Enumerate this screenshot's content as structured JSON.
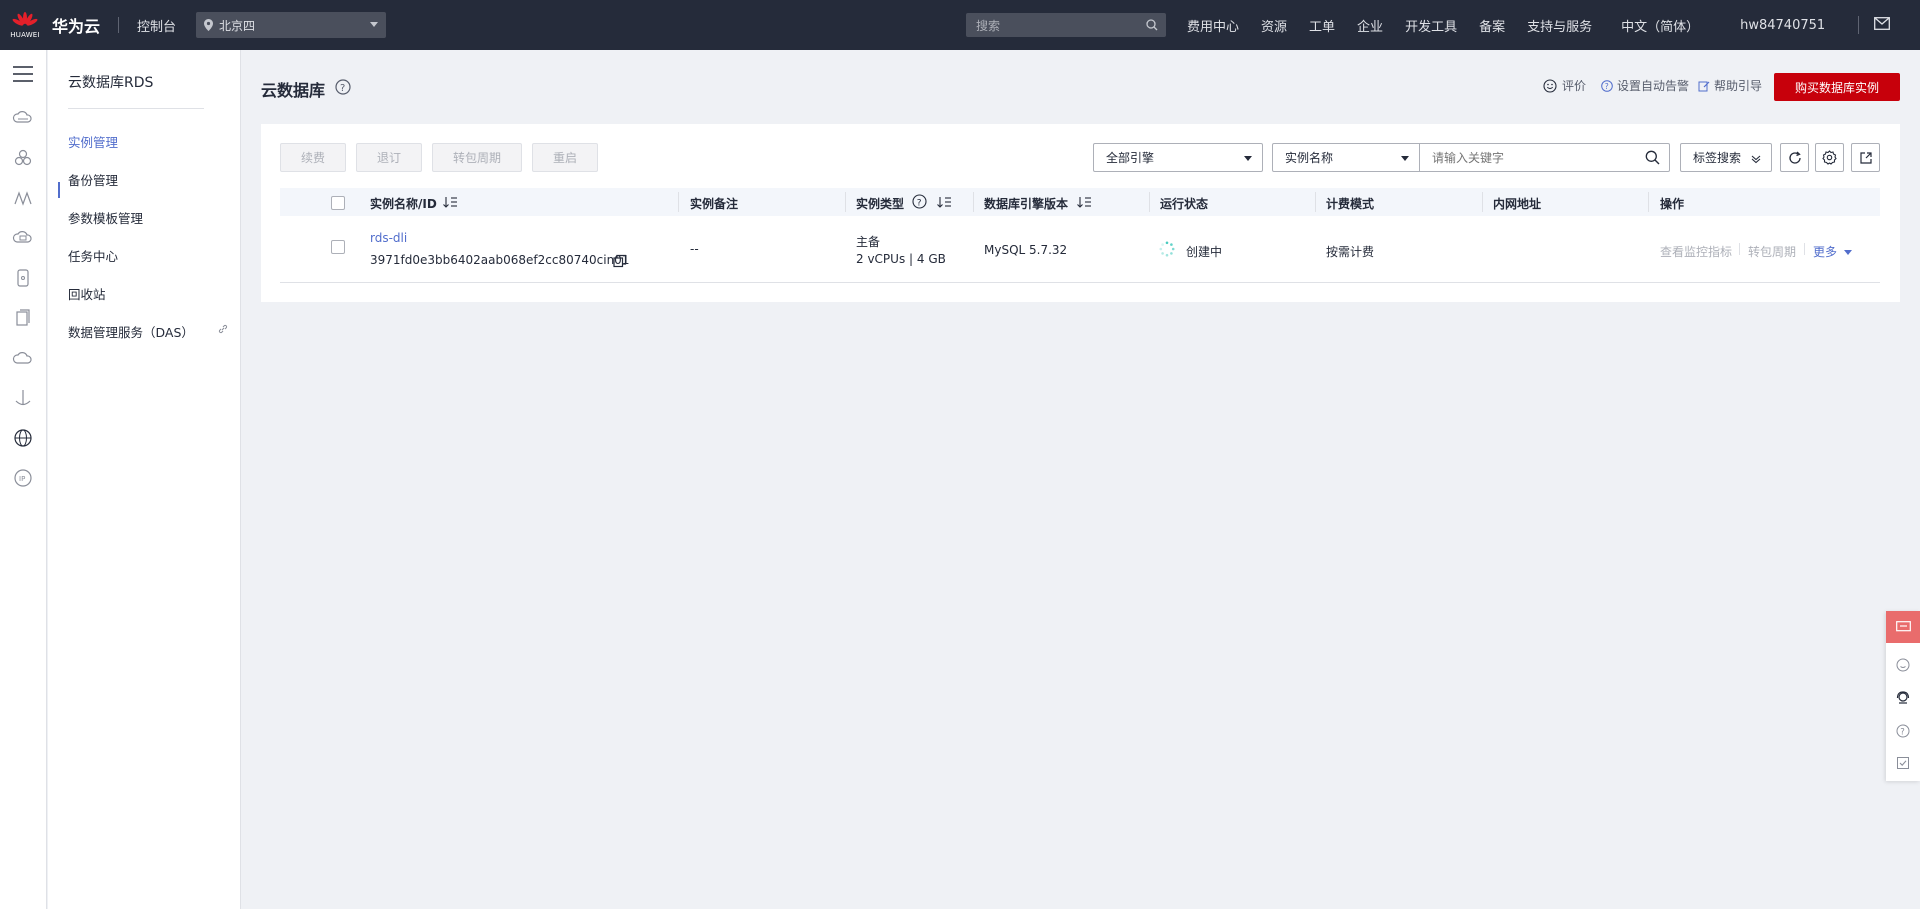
{
  "topbar": {
    "brand_cn": "华为云",
    "brand_small": "HUAWEI",
    "console": "控制台",
    "region": "北京四",
    "search_placeholder": "搜索",
    "nav": [
      "费用中心",
      "资源",
      "工单",
      "企业",
      "开发工具",
      "备案",
      "支持与服务",
      "中文（简体）",
      "hw84740751"
    ]
  },
  "sidemenu": {
    "title": "云数据库RDS",
    "items": [
      "实例管理",
      "备份管理",
      "参数模板管理",
      "任务中心",
      "回收站",
      "数据管理服务（DAS）"
    ]
  },
  "page": {
    "title": "云数据库",
    "rate": "评价",
    "alarm": "设置自动告警",
    "guide": "帮助引导",
    "buy": "购买数据库实例"
  },
  "toolbar": {
    "renew": "续费",
    "unsubscribe": "退订",
    "to_monthly": "转包周期",
    "restart": "重启",
    "engine_filter": "全部引擎",
    "search_field": "实例名称",
    "keyword_placeholder": "请输入关键字",
    "tag_search": "标签搜索"
  },
  "table": {
    "columns": [
      "实例名称/ID",
      "实例备注",
      "实例类型",
      "数据库引擎版本",
      "运行状态",
      "计费模式",
      "内网地址",
      "操作"
    ],
    "rows": [
      {
        "name": "rds-dli",
        "id": "3971fd0e3bb6402aab068ef2cc80740cin01",
        "remark": "--",
        "type": "主备",
        "spec": "2 vCPUs | 4 GB",
        "engine": "MySQL 5.7.32",
        "status": "创建中",
        "billing": "按需计费",
        "address": "",
        "ops": [
          "查看监控指标",
          "转包周期",
          "更多"
        ]
      }
    ]
  },
  "colors": {
    "topbar_bg": "#252b3a",
    "accent_blue": "#526ecc",
    "brand_red": "#c7000b",
    "status_creating": "#47cbbf"
  }
}
